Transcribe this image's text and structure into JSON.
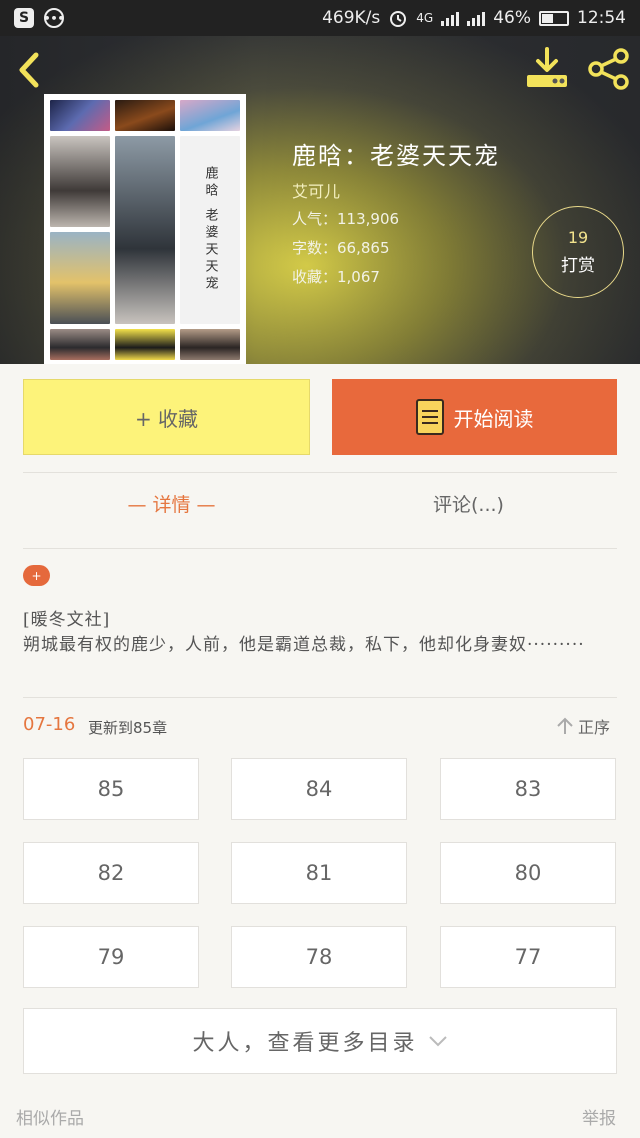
{
  "status_bar": {
    "net_speed": "469K/s",
    "network": "4G",
    "battery": "46%",
    "battery_level": 0.46,
    "time": "12:54"
  },
  "book": {
    "title": "鹿晗：老婆天天宠",
    "author": "艾可儿",
    "popularity": "人气：113,906",
    "word_count": "字数：66,865",
    "favorites": "收藏：1,067",
    "cover_text": "鹿晗 老婆天天宠"
  },
  "tip": {
    "count": "19",
    "label": "打赏"
  },
  "actions": {
    "favorite": "+ 收藏",
    "read": "开始阅读"
  },
  "tabs": {
    "detail": "— 详情 —",
    "comments": "评论(...)"
  },
  "tag": "+",
  "description": "[暖冬文社]\n朔城最有权的鹿少，人前，他是霸道总裁，私下，他却化身妻奴·········",
  "update": {
    "date": "07-16",
    "text": "更新到85章",
    "sort": "正序"
  },
  "chapters": [
    "85",
    "84",
    "83",
    "82",
    "81",
    "80",
    "79",
    "78",
    "77"
  ],
  "more_catalog": "大人，查看更多目录",
  "footer": {
    "similar": "相似作品",
    "report": "举报"
  },
  "colors": {
    "accent": "#e5693c",
    "favorite_bg": "#fdf37a",
    "page_bg": "#f7f6f2"
  },
  "icons": [
    "back-icon",
    "download-icon",
    "share-icon",
    "book-icon",
    "sort-up-icon",
    "chevron-down-icon"
  ]
}
